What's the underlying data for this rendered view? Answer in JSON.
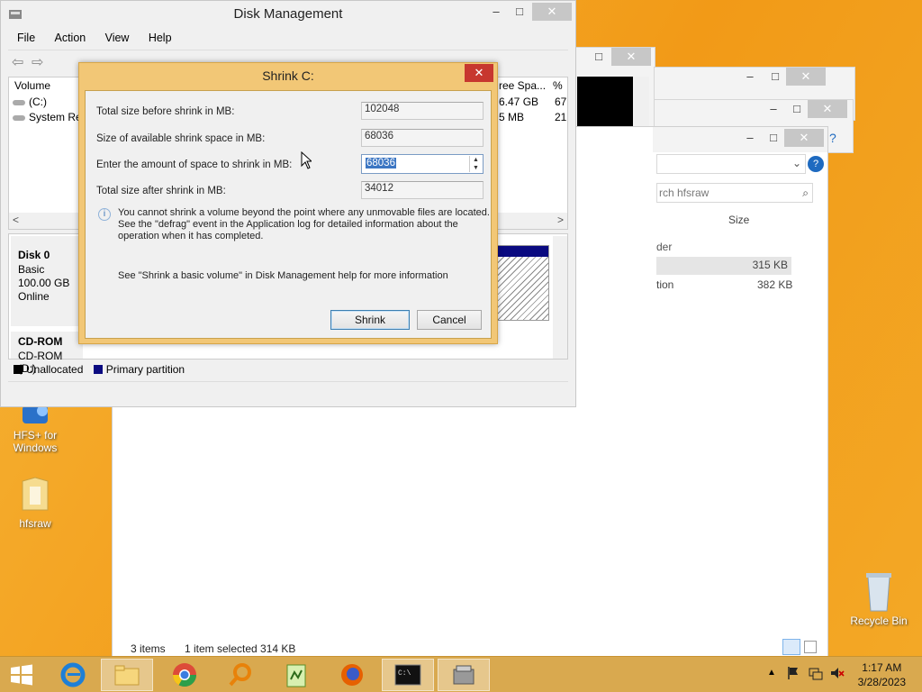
{
  "desktop": {
    "icons": [
      {
        "label": "HFS+ for Windows"
      },
      {
        "label": "hfsraw"
      },
      {
        "label": "Recycle Bin"
      }
    ]
  },
  "explorer": {
    "search_placeholder": "rch hfsraw",
    "size_header": "Size",
    "rows": [
      {
        "name": "der",
        "size": ""
      },
      {
        "name": "",
        "size": "315 KB"
      },
      {
        "name": "tion",
        "size": "382 KB"
      }
    ],
    "status_items": "3 items",
    "status_selected": "1 item selected  314 KB"
  },
  "disk_mgmt": {
    "title": "Disk Management",
    "menu": [
      "File",
      "Action",
      "View",
      "Help"
    ],
    "columns": {
      "volume": "Volume",
      "free": "ree Spa...",
      "pct": "% F"
    },
    "volumes": [
      {
        "name": "(C:)",
        "free": "6.47 GB",
        "pct": "67"
      },
      {
        "name": "System Res",
        "free": "5 MB",
        "pct": "21"
      }
    ],
    "disk0": {
      "name": "Disk 0",
      "type": "Basic",
      "size": "100.00 GB",
      "status": "Online"
    },
    "cdrom": {
      "name": "CD-ROM",
      "label": "CD-ROM (D:)"
    },
    "legend": {
      "unallocated": "Unallocated",
      "primary": "Primary partition"
    }
  },
  "shrink_dialog": {
    "title": "Shrink C:",
    "total_before_label": "Total size before shrink in MB:",
    "total_before_value": "102048",
    "available_label": "Size of available shrink space in MB:",
    "available_value": "68036",
    "amount_label": "Enter the amount of space to shrink in MB:",
    "amount_value": "68036",
    "total_after_label": "Total size after shrink in MB:",
    "total_after_value": "34012",
    "info_text_1": "You cannot shrink a volume beyond the point where any unmovable files are located.",
    "info_text_2": "See the \"defrag\" event in the Application log for detailed information about the",
    "info_text_3": "operation when it has completed.",
    "help_text": "See \"Shrink a basic volume\" in Disk Management help for more information",
    "shrink_button": "Shrink",
    "cancel_button": "Cancel"
  },
  "taskbar": {
    "time": "1:17 AM",
    "date": "3/28/2023"
  },
  "colors": {
    "desktop": "#f3a51d",
    "dialog_frame": "#f2c776",
    "primary_partition": "#0a0a80",
    "close_red": "#c7372f"
  }
}
